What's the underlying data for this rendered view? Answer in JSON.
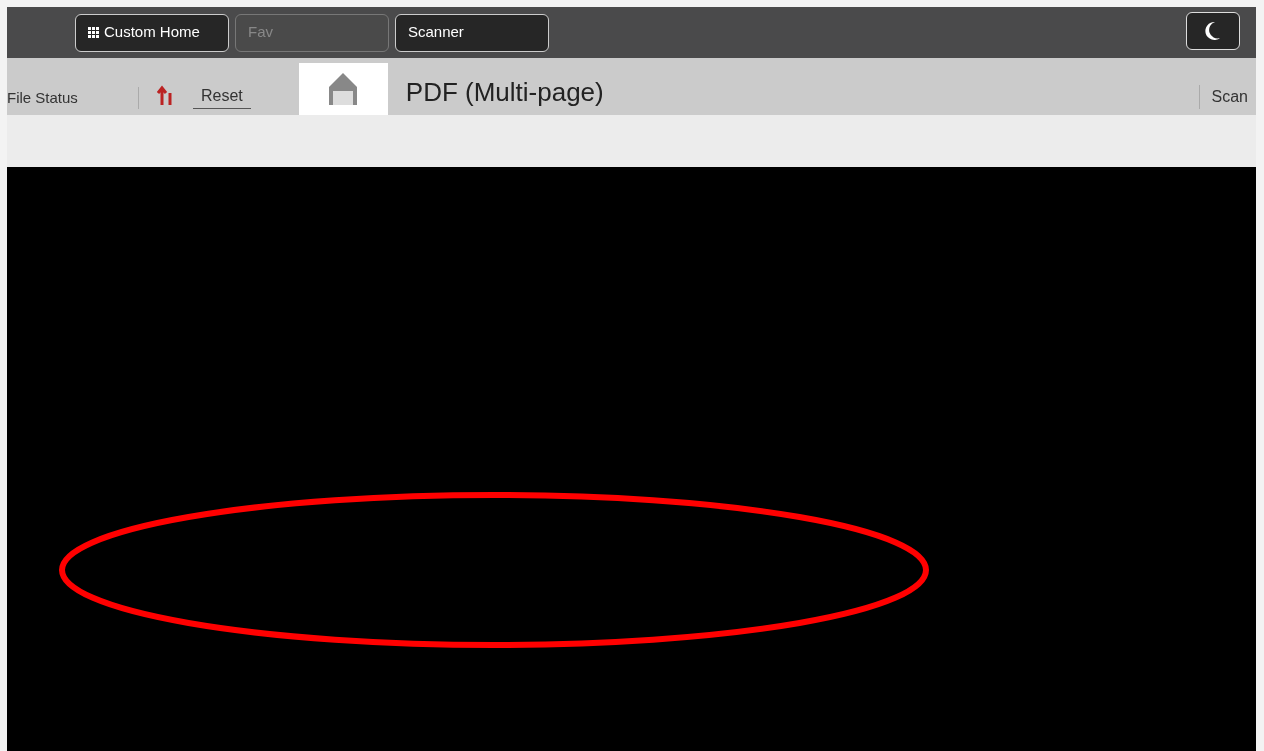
{
  "tabs": [
    {
      "label": "Custom Home",
      "disabled": false
    },
    {
      "label": "Fav",
      "disabled": true
    },
    {
      "label": "Scanner",
      "disabled": false
    }
  ],
  "toolbar": {
    "file_status": "File Status",
    "reset": "Reset",
    "format": "PDF (Multi-page)",
    "scan": "Scan"
  }
}
